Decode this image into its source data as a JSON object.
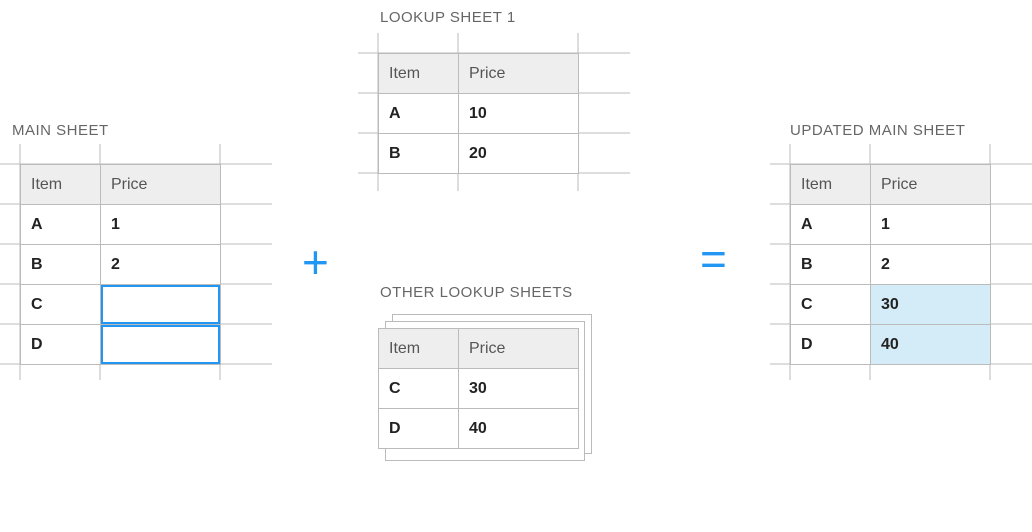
{
  "titles": {
    "main": "MAIN SHEET",
    "lookup1": "LOOKUP SHEET 1",
    "other": "OTHER LOOKUP SHEETS",
    "updated": "UPDATED MAIN SHEET"
  },
  "headers": {
    "item": "Item",
    "price": "Price"
  },
  "operators": {
    "plus": "+",
    "equals": "="
  },
  "main": {
    "r0": {
      "item": "A",
      "price": "1"
    },
    "r1": {
      "item": "B",
      "price": "2"
    },
    "r2": {
      "item": "C",
      "price": ""
    },
    "r3": {
      "item": "D",
      "price": ""
    }
  },
  "lookup1": {
    "r0": {
      "item": "A",
      "price": "10"
    },
    "r1": {
      "item": "B",
      "price": "20"
    }
  },
  "other": {
    "r0": {
      "item": "C",
      "price": "30"
    },
    "r1": {
      "item": "D",
      "price": "40"
    }
  },
  "updated": {
    "r0": {
      "item": "A",
      "price": "1"
    },
    "r1": {
      "item": "B",
      "price": "2"
    },
    "r2": {
      "item": "C",
      "price": "30"
    },
    "r3": {
      "item": "D",
      "price": "40"
    }
  }
}
